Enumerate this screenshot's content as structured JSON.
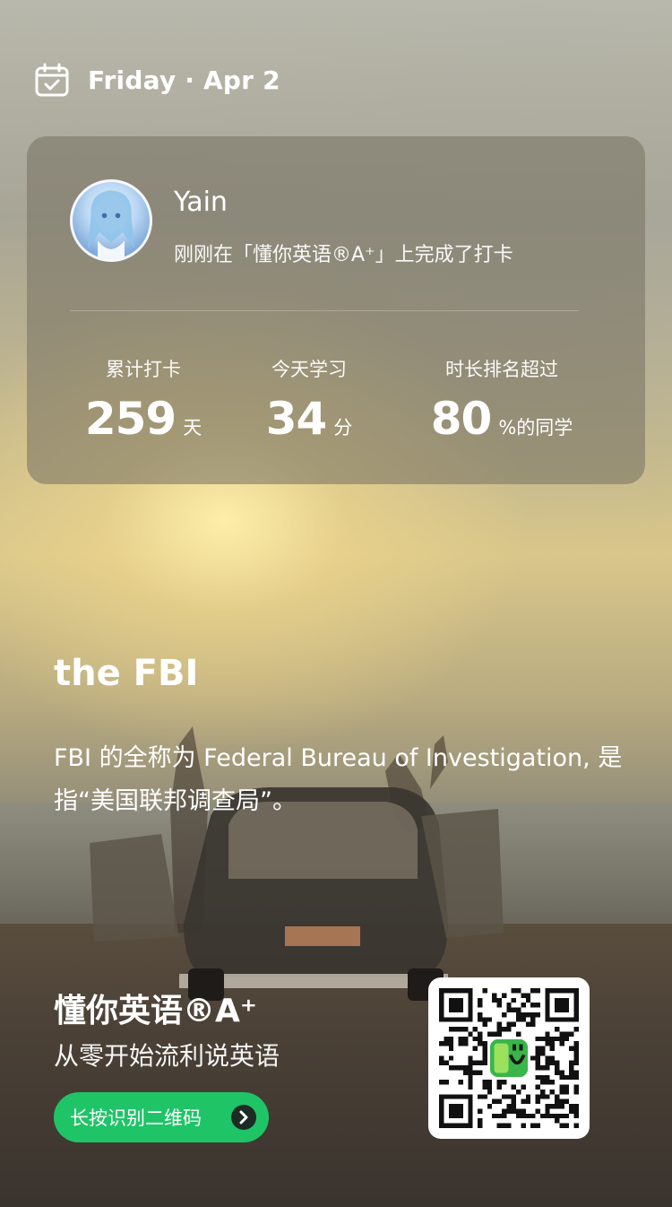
{
  "header": {
    "date": "Friday · Apr 2"
  },
  "checkin_card": {
    "user_name": "Yain",
    "status": "刚刚在「懂你英语®A⁺」上完成了打卡",
    "stats": [
      {
        "label": "累计打卡",
        "value": "259",
        "unit": "天"
      },
      {
        "label": "今天学习",
        "value": "34",
        "unit": "分"
      },
      {
        "label": "时长排名超过",
        "value": "80",
        "unit": "%的同学"
      }
    ]
  },
  "word": {
    "title": "the FBI",
    "definition": "FBI 的全称为 Federal Bureau of Investigation, 是指“美国联邦调查局”。"
  },
  "brand": {
    "name": "懂你英语®A⁺",
    "slogan": "从零开始流利说英语",
    "qr_button_label": "长按识别二维码"
  },
  "icons": {
    "calendar": "calendar-check-icon",
    "arrow": "chevron-right-icon",
    "qr": "qr-code-icon",
    "app_logo": "app-logo-icon"
  },
  "colors": {
    "accent_green": "#1fc467",
    "card_bg": "rgba(120,115,100,0.58)"
  }
}
